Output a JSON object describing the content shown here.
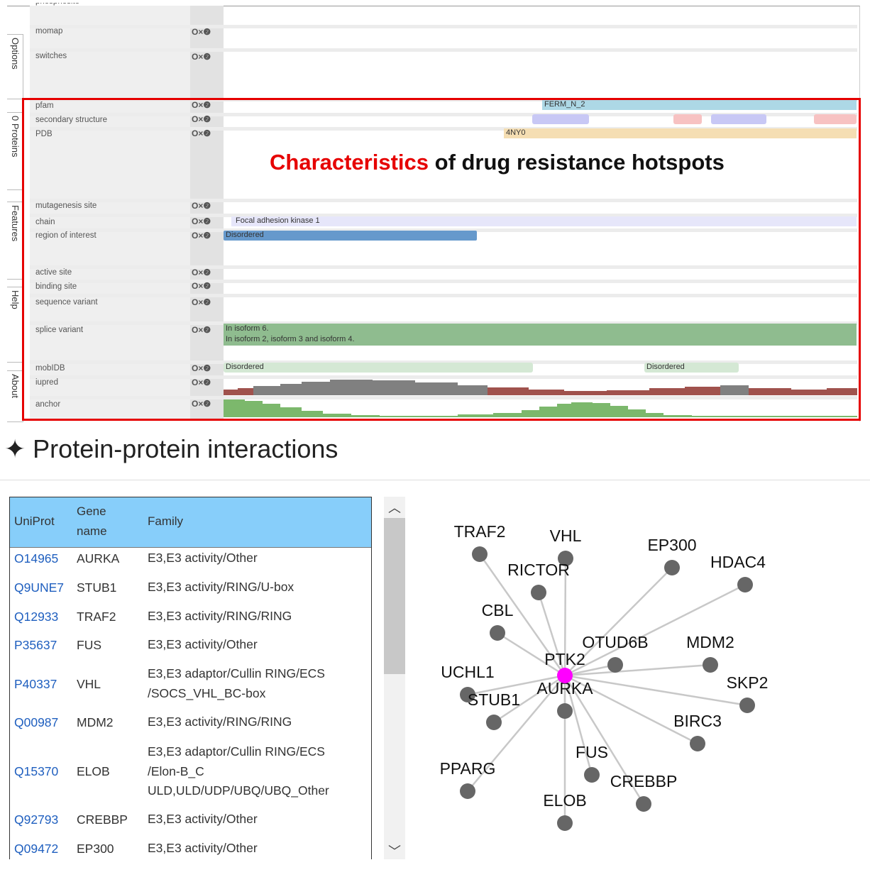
{
  "viewer": {
    "side_tabs": [
      "Options",
      "0 Proteins",
      "Features",
      "Help",
      "About"
    ],
    "control_icons": "O×❷",
    "top_cutoff_label": "phosphosite",
    "tracks": [
      {
        "key": "momap",
        "label": "momap"
      },
      {
        "key": "switches",
        "label": "switches"
      },
      {
        "key": "pfam",
        "label": "pfam",
        "feature": "FERM_N_2"
      },
      {
        "key": "secondary_structure",
        "label": "secondary structure"
      },
      {
        "key": "pdb",
        "label": "PDB",
        "feature": "4NY0"
      },
      {
        "key": "mutagenesis",
        "label": "mutagenesis site"
      },
      {
        "key": "chain",
        "label": "chain",
        "feature": "Focal adhesion kinase 1"
      },
      {
        "key": "region",
        "label": "region of interest",
        "feature": "Disordered"
      },
      {
        "key": "active_site",
        "label": "active site"
      },
      {
        "key": "binding_site",
        "label": "binding site"
      },
      {
        "key": "sequence_variant",
        "label": "sequence variant"
      },
      {
        "key": "splice_variant",
        "label": "splice variant",
        "feature_line1": "In isoform 6.",
        "feature_line2": "In isoform 2, isoform 3 and isoform 4."
      },
      {
        "key": "mobidb",
        "label": "mobIDB",
        "feature": "Disordered",
        "feature2": "Disordered"
      },
      {
        "key": "iupred",
        "label": "iupred"
      },
      {
        "key": "anchor",
        "label": "anchor"
      }
    ]
  },
  "overlay": {
    "title_highlight": "Characteristics",
    "title_rest": " of drug resistance hotspots",
    "highlight_color": "#e60000"
  },
  "ppi": {
    "heading": "✦ Protein-protein interactions",
    "table": {
      "headers": [
        "UniProt",
        "Gene name",
        "Family"
      ],
      "header_lines": {
        "gene_line1": "Gene",
        "gene_line2": "name"
      },
      "rows": [
        {
          "uniprot": "O14965",
          "gene": "AURKA",
          "family": "E3,E3 activity/Other"
        },
        {
          "uniprot": "Q9UNE7",
          "gene": "STUB1",
          "family": "E3,E3 activity/RING/U-box"
        },
        {
          "uniprot": "Q12933",
          "gene": "TRAF2",
          "family": "E3,E3 activity/RING/RING"
        },
        {
          "uniprot": "P35637",
          "gene": "FUS",
          "family": "E3,E3 activity/Other"
        },
        {
          "uniprot": "P40337",
          "gene": "VHL",
          "family": "E3,E3 adaptor/Cullin RING/ECS\n/SOCS_VHL_BC-box"
        },
        {
          "uniprot": "Q00987",
          "gene": "MDM2",
          "family": "E3,E3 activity/RING/RING"
        },
        {
          "uniprot": "Q15370",
          "gene": "ELOB",
          "family": "E3,E3 adaptor/Cullin RING/ECS\n/Elon-B_C\nULD,ULD/UDP/UBQ/UBQ_Other"
        },
        {
          "uniprot": "Q92793",
          "gene": "CREBBP",
          "family": "E3,E3 activity/Other"
        },
        {
          "uniprot": "Q09472",
          "gene": "EP300",
          "family": "E3,E3 activity/Other"
        }
      ]
    },
    "network": {
      "center": "PTK2",
      "center_color": "#ff00ff",
      "node_color": "#666666",
      "nodes": [
        "TRAF2",
        "VHL",
        "EP300",
        "HDAC4",
        "RICTOR",
        "CBL",
        "OTUD6B",
        "MDM2",
        "UCHL1",
        "SKP2",
        "STUB1",
        "AURKA",
        "BIRC3",
        "FUS",
        "PPARG",
        "CREBBP",
        "ELOB"
      ],
      "visible_labels": {
        "HDAC4": "HDAC4"
      }
    }
  },
  "colors": {
    "pfam": "#add8e6",
    "helix": "#c8c8f5",
    "strand": "#f7c2c2",
    "pdb": "#f5deb3",
    "chain": "#e6e6fa",
    "region": "#6699cc",
    "splice": "#8fbc8f",
    "mobidb": "#d4e8d4",
    "iupred_high": "#808080",
    "iupred_low": "#a0524d",
    "anchor": "#7cb86c"
  }
}
